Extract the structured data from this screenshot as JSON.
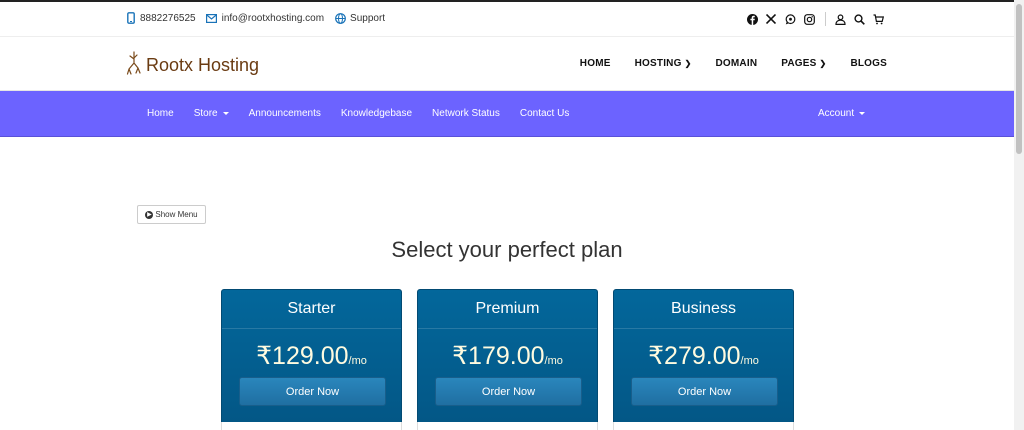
{
  "topbar": {
    "phone": "8882276525",
    "email": "info@rootxhosting.com",
    "support": "Support",
    "social_icons": [
      "facebook-icon",
      "x-twitter-icon",
      "whatsapp-icon",
      "instagram-icon"
    ],
    "utility_icons": [
      "user-icon",
      "search-icon",
      "cart-icon"
    ]
  },
  "header": {
    "logo_text": "Rootx Hosting",
    "nav": [
      {
        "label": "HOME"
      },
      {
        "label": "HOSTING",
        "dropdown": true
      },
      {
        "label": "DOMAIN"
      },
      {
        "label": "PAGES",
        "dropdown": true
      },
      {
        "label": "BLOGS"
      }
    ]
  },
  "portal_nav": {
    "items": [
      "Home",
      "Store",
      "Announcements",
      "Knowledgebase",
      "Network Status",
      "Contact Us"
    ],
    "account": "Account",
    "color": "#6c63ff"
  },
  "content": {
    "show_menu": "Show Menu",
    "heading": "Select your perfect plan",
    "plans": [
      {
        "name": "Starter",
        "price": "₹129.00",
        "period": "/mo",
        "cta": "Order Now"
      },
      {
        "name": "Premium",
        "price": "₹179.00",
        "period": "/mo",
        "cta": "Order Now"
      },
      {
        "name": "Business",
        "price": "₹279.00",
        "period": "/mo",
        "cta": "Order Now"
      }
    ]
  }
}
